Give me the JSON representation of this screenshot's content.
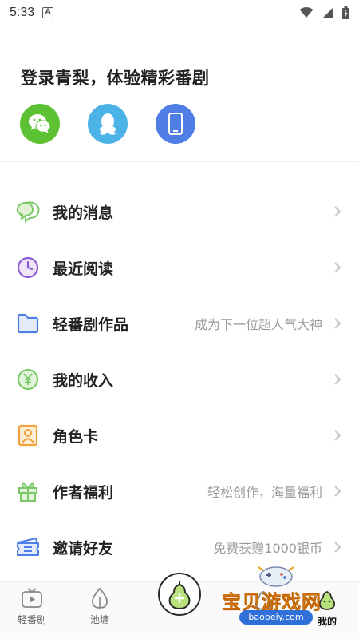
{
  "status_bar": {
    "time": "5:33"
  },
  "login": {
    "title": "登录青梨，体验精彩番剧",
    "buttons": [
      {
        "name": "wechat",
        "color": "#5cc233",
        "icon": "wechat-icon"
      },
      {
        "name": "qq",
        "color": "#4cb3e9",
        "icon": "qq-penguin-icon"
      },
      {
        "name": "phone",
        "color": "#4f7fe6",
        "icon": "phone-icon"
      }
    ]
  },
  "menu": {
    "items": [
      {
        "label": "我的消息",
        "sub": "",
        "icon": "message-bubble-icon",
        "color": "#7cc96a"
      },
      {
        "label": "最近阅读",
        "sub": "",
        "icon": "clock-icon",
        "color": "#8e5bd6"
      },
      {
        "label": "轻番剧作品",
        "sub": "成为下一位超人气大神",
        "icon": "folder-icon",
        "color": "#4f7fe6"
      },
      {
        "label": "我的收入",
        "sub": "",
        "icon": "yen-coin-icon",
        "color": "#7cc96a"
      },
      {
        "label": "角色卡",
        "sub": "",
        "icon": "character-card-icon",
        "color": "#f2a23a"
      },
      {
        "label": "作者福利",
        "sub": "轻松创作，海量福利",
        "icon": "gift-icon",
        "color": "#7cc96a"
      },
      {
        "label": "邀请好友",
        "sub": "免费获赠1000银币",
        "icon": "ticket-icon",
        "color": "#4f7fe6"
      }
    ]
  },
  "bottom_nav": {
    "items": [
      {
        "label": "轻番剧",
        "icon": "tv-icon"
      },
      {
        "label": "池塘",
        "icon": "water-drop-icon"
      },
      {
        "label": "",
        "icon": "pear-create-icon"
      },
      {
        "label": "",
        "icon": "pear-icon"
      },
      {
        "label": "我的",
        "icon": "pear-profile-icon",
        "active": true
      }
    ]
  },
  "watermark": {
    "text": "宝贝游戏网",
    "url": "baobeiy.com"
  }
}
